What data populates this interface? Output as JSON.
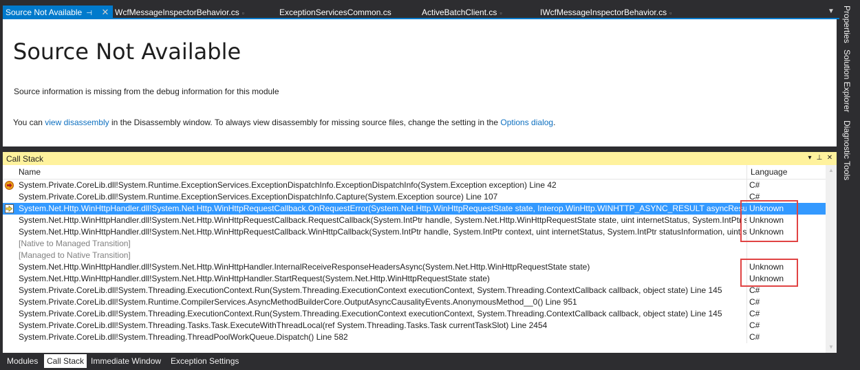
{
  "doc_tabs": [
    {
      "label": "Source Not Available",
      "active": true
    },
    {
      "label": "WcfMessageInspectorBehavior.cs"
    },
    {
      "label": "ExceptionServicesCommon.cs"
    },
    {
      "label": "ActiveBatchClient.cs"
    },
    {
      "label": "IWcfMessageInspectorBehavior.cs"
    }
  ],
  "doc": {
    "title": "Source Not Available",
    "info": "Source information is missing from the debug information for this module",
    "line_prefix": "You can ",
    "link_disassembly": "view disassembly",
    "line_middle": " in the Disassembly window. To always view disassembly for missing source files, change the setting in the ",
    "link_options": "Options dialog",
    "line_suffix": "."
  },
  "side_tabs": [
    "Properties",
    "Solution Explorer",
    "Diagnostic Tools"
  ],
  "call_stack": {
    "title": "Call Stack",
    "col_name": "Name",
    "col_language": "Language",
    "rows": [
      {
        "name": "System.Private.CoreLib.dll!System.Runtime.ExceptionServices.ExceptionDispatchInfo.ExceptionDispatchInfo(System.Exception exception) Line 42",
        "language": "C#",
        "indicator": "exception"
      },
      {
        "name": "System.Private.CoreLib.dll!System.Runtime.ExceptionServices.ExceptionDispatchInfo.Capture(System.Exception source) Line 107",
        "language": "C#"
      },
      {
        "name": "System.Net.Http.WinHttpHandler.dll!System.Net.Http.WinHttpRequestCallback.OnRequestError(System.Net.Http.WinHttpRequestState state, Interop.WinHttp.WINHTTP_ASYNC_RESULT asyncResult)",
        "language": "Unknown",
        "indicator": "current",
        "selected": true
      },
      {
        "name": "System.Net.Http.WinHttpHandler.dll!System.Net.Http.WinHttpRequestCallback.RequestCallback(System.IntPtr handle, System.Net.Http.WinHttpRequestState state, uint internetStatus, System.IntPtr stat",
        "language": "Unknown"
      },
      {
        "name": "System.Net.Http.WinHttpHandler.dll!System.Net.Http.WinHttpRequestCallback.WinHttpCallback(System.IntPtr handle, System.IntPtr context, uint internetStatus, System.IntPtr statusInformation, uint st",
        "language": "Unknown"
      },
      {
        "name": "[Native to Managed Transition]",
        "language": "",
        "gray": true
      },
      {
        "name": "[Managed to Native Transition]",
        "language": "",
        "gray": true
      },
      {
        "name": "System.Net.Http.WinHttpHandler.dll!System.Net.Http.WinHttpHandler.InternalReceiveResponseHeadersAsync(System.Net.Http.WinHttpRequestState state)",
        "language": "Unknown"
      },
      {
        "name": "System.Net.Http.WinHttpHandler.dll!System.Net.Http.WinHttpHandler.StartRequest(System.Net.Http.WinHttpRequestState state)",
        "language": "Unknown"
      },
      {
        "name": "System.Private.CoreLib.dll!System.Threading.ExecutionContext.Run(System.Threading.ExecutionContext executionContext, System.Threading.ContextCallback callback, object state) Line 145",
        "language": "C#"
      },
      {
        "name": "System.Private.CoreLib.dll!System.Runtime.CompilerServices.AsyncMethodBuilderCore.OutputAsyncCausalityEvents.AnonymousMethod__0() Line 951",
        "language": "C#"
      },
      {
        "name": "System.Private.CoreLib.dll!System.Threading.ExecutionContext.Run(System.Threading.ExecutionContext executionContext, System.Threading.ContextCallback callback, object state) Line 145",
        "language": "C#"
      },
      {
        "name": "System.Private.CoreLib.dll!System.Threading.Tasks.Task.ExecuteWithThreadLocal(ref System.Threading.Tasks.Task currentTaskSlot) Line 2454",
        "language": "C#"
      },
      {
        "name": "System.Private.CoreLib.dll!System.Threading.ThreadPoolWorkQueue.Dispatch() Line 582",
        "language": "C#"
      }
    ]
  },
  "bottom_tabs": [
    {
      "label": "Modules"
    },
    {
      "label": "Call Stack",
      "active": true
    },
    {
      "label": "Immediate Window"
    },
    {
      "label": "Exception Settings"
    }
  ],
  "colors": {
    "accent": "#007acc",
    "selection": "#3399ff",
    "highlight_box": "#e04343",
    "toolwindow_header": "#fff29d"
  }
}
